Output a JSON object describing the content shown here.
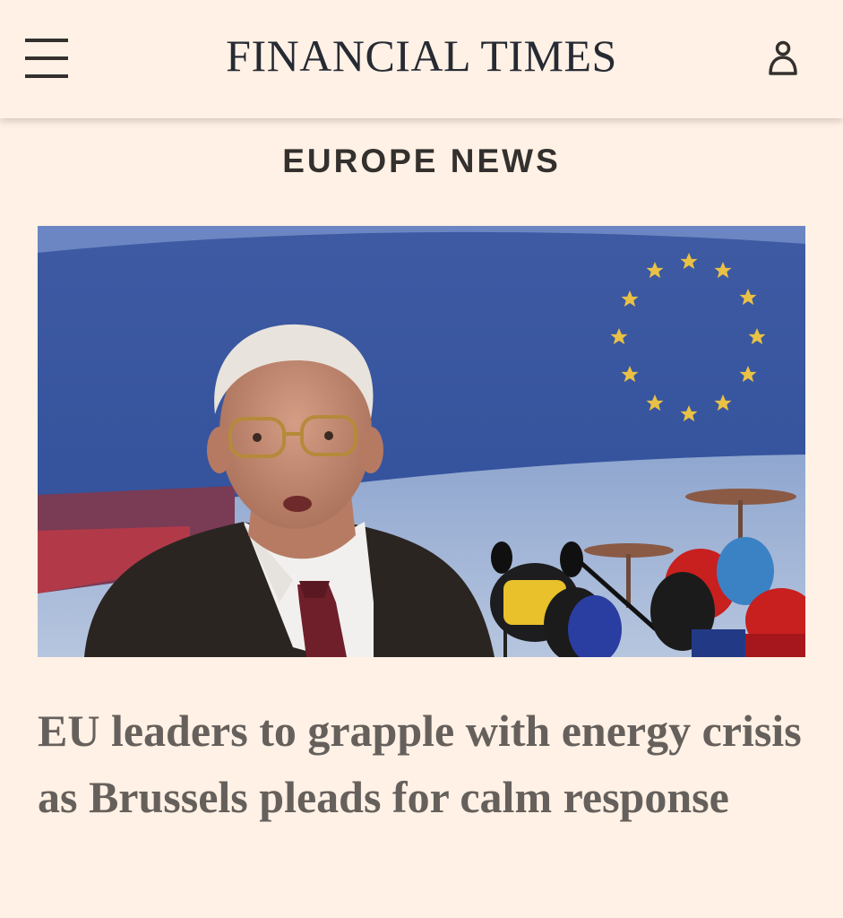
{
  "header": {
    "brand": "FINANCIAL TIMES",
    "menu_icon": "hamburger-menu-icon",
    "account_icon": "user-account-icon"
  },
  "section": {
    "label": "EUROPE NEWS"
  },
  "article": {
    "headline": "EU leaders to grapple with energy crisis as Brussels pleads for calm response",
    "image_description_icon": "press-conference-photo"
  },
  "colors": {
    "background": "#fff1e5",
    "brand_text": "#262a33",
    "section_text": "#33302e",
    "headline_text": "#66605c"
  }
}
